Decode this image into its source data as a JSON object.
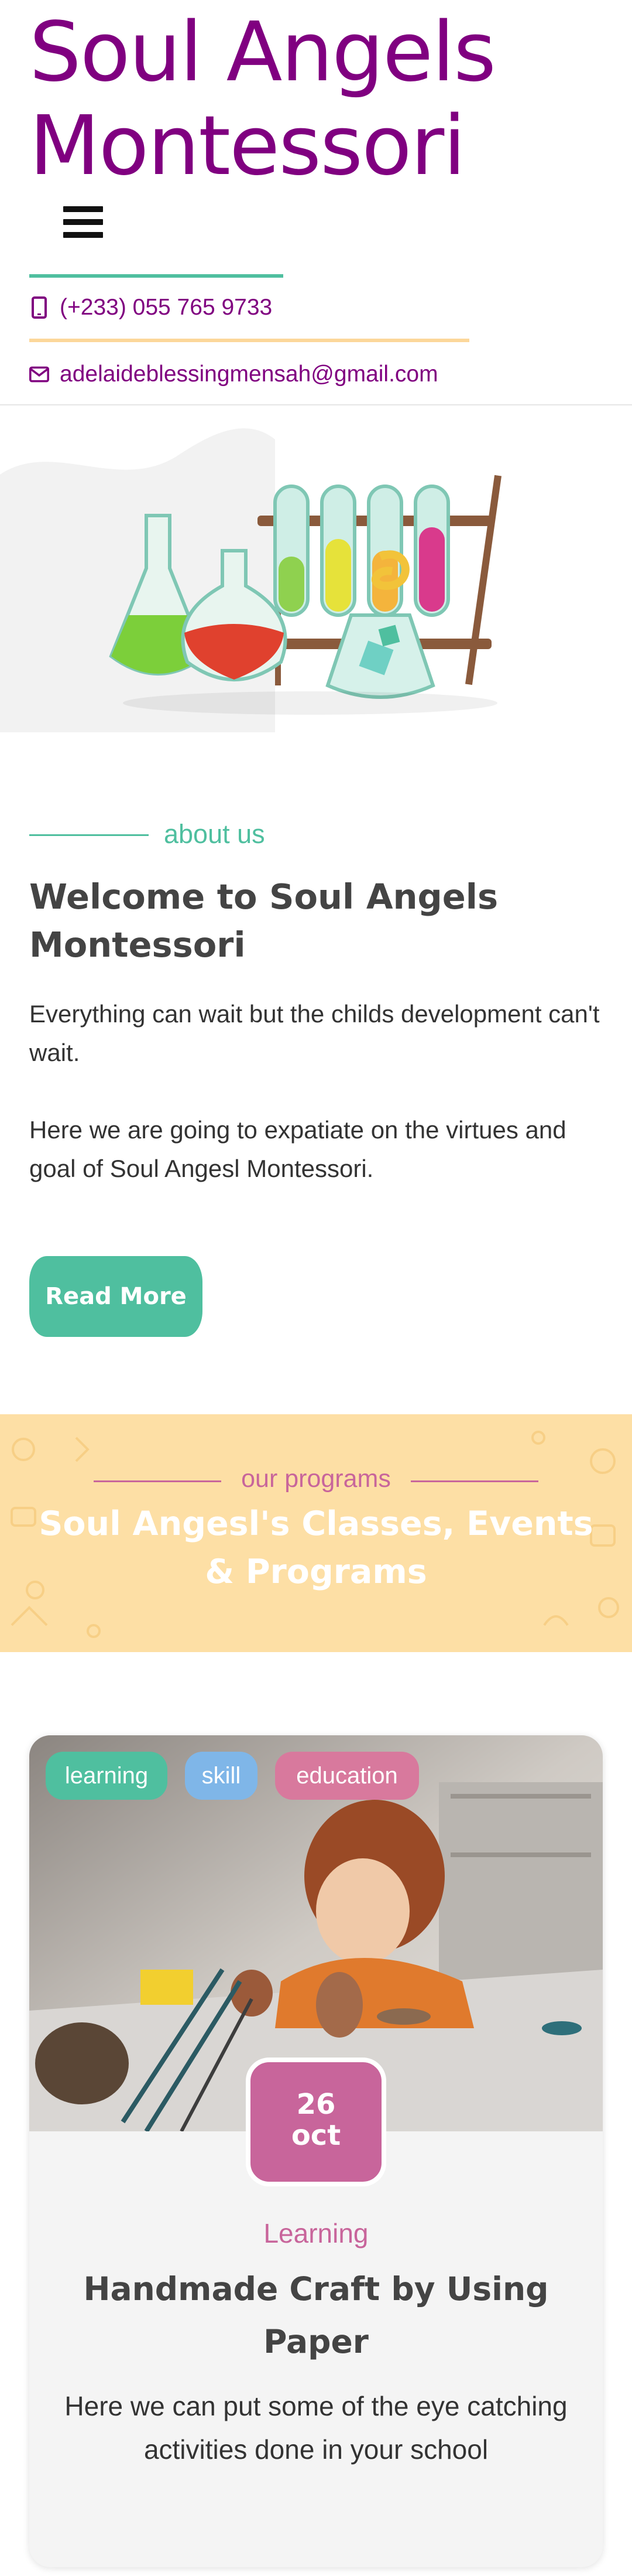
{
  "header": {
    "site_title": "Soul Angels Montessori",
    "phone": "(+233) 055 765 9733",
    "email": "adelaideblessingmensah@gmail.com"
  },
  "about": {
    "label": "about us",
    "title": "Welcome to Soul Angels Montessori",
    "paragraph_1": "Everything can wait but the childs development can't wait.",
    "paragraph_2": "Here we are going to expatiate on the virtues and goal of Soul Angesl Montessori.",
    "read_more_label": "Read More"
  },
  "programs": {
    "label": "our programs",
    "title": "Soul Angesl's Classes, Events & Programs"
  },
  "card": {
    "tags": [
      "learning",
      "skill",
      "education"
    ],
    "date_day": "26",
    "date_month": "oct",
    "category": "Learning",
    "title": "Handmade Craft by Using Paper",
    "text": "Here we can put some of the eye catching activities done in your school"
  },
  "colors": {
    "brand_purple": "#800080",
    "accent_teal": "#4fbf9f",
    "accent_pink": "#c8659b",
    "accent_yellow": "#fddfa5",
    "tag_blue": "#7fb6e8"
  },
  "icons": {
    "menu": "hamburger-icon",
    "phone": "mobile-phone-icon",
    "email": "envelope-icon"
  }
}
